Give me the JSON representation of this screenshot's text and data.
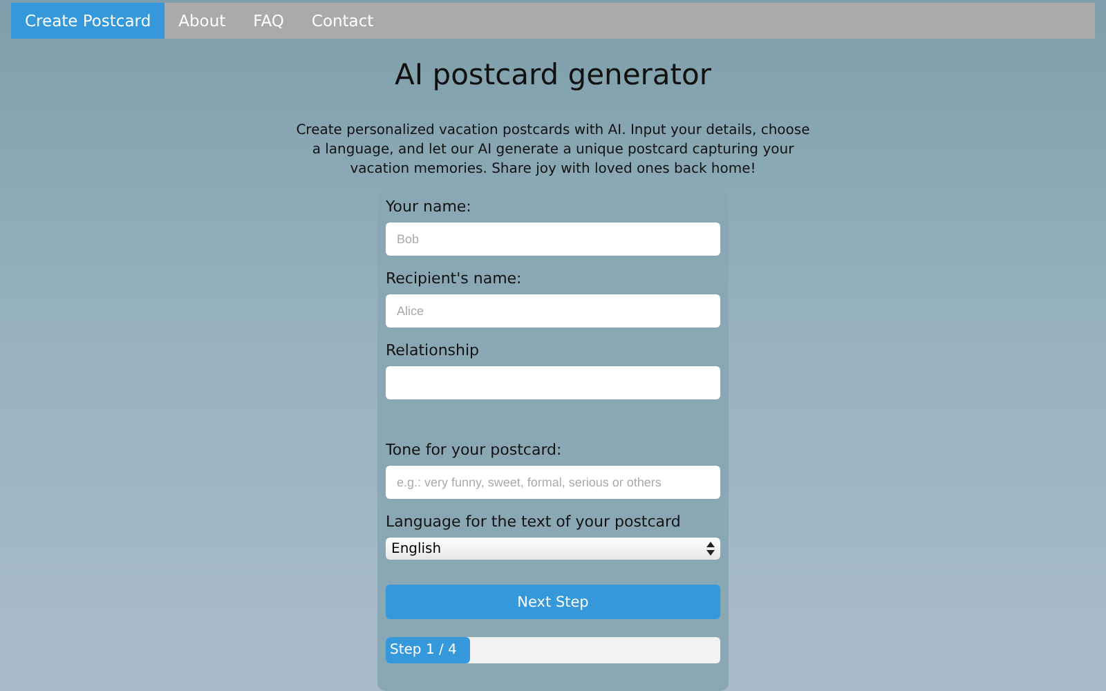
{
  "nav": [
    {
      "label": "Create Postcard",
      "selected": true
    },
    {
      "label": "About",
      "selected": false
    },
    {
      "label": "FAQ",
      "selected": false
    },
    {
      "label": "Contact",
      "selected": false
    }
  ],
  "title": "AI postcard generator",
  "description": "Create personalized vacation postcards with AI. Input your details, choose a language, and let our AI generate a unique postcard capturing your vacation memories. Share joy with loved ones back home!",
  "form": {
    "fields": [
      {
        "kind": "text",
        "label": "Your name:",
        "placeholder": "Bob"
      },
      {
        "kind": "text",
        "label": "Recipient's name:",
        "placeholder": "Alice"
      },
      {
        "kind": "text",
        "label": "Relationship"
      },
      {
        "kind": "spacer"
      },
      {
        "kind": "text",
        "label": "Tone for your postcard:",
        "placeholder": "e.g.: very funny, sweet, formal, serious or others"
      },
      {
        "kind": "select",
        "label": "Language for the text of your postcard",
        "value": "English"
      }
    ],
    "button": "Next Step",
    "progress": {
      "label": "Step 1 / 4",
      "level": 0.25
    }
  }
}
